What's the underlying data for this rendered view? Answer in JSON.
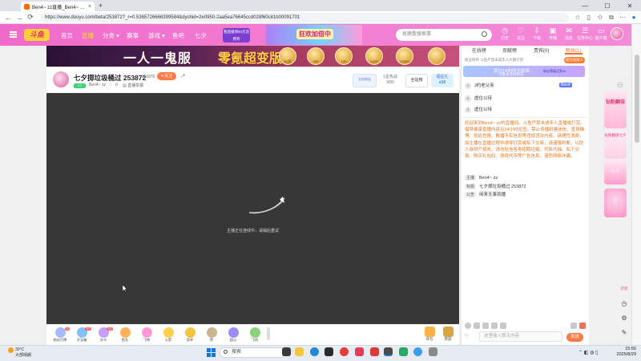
{
  "browser": {
    "tab_title": "Ben4~ zz直播_Ben4~ zz直播_Be...",
    "tab_close": "×",
    "new_tab": "+",
    "url": "https://www.douyu.com/beta/253872?_r=0.5365726666399584&dyshid=2e0950-2aa5ea76645ccd028f60c81b00091701",
    "nav_back": "←",
    "nav_forward": "→",
    "nav_reload": "⟳"
  },
  "site": {
    "logo": "斗鱼",
    "nav": [
      "首页",
      "直播",
      "分类",
      "赛事",
      "游戏",
      "鱼吧",
      "七夕"
    ],
    "promo_small": "看直播领60元话费券",
    "promo_banner": "狂欢加倍中",
    "search_placeholder": "斑鹿散搜索事",
    "header_icons": [
      "历史",
      "关注",
      "下载",
      "开播",
      "消息",
      "任务中心",
      "客户端"
    ]
  },
  "banner": {
    "text1": "一人一鬼服",
    "text2": "零氪超变版",
    "coins": [
      "5Q奖",
      "200",
      "100",
      "1Q2P",
      "12300"
    ]
  },
  "room": {
    "title": "七夕掷垃圾桶过 253872",
    "hot": "110976",
    "follow": "♥ 关注",
    "level": "LV",
    "anchor": "Ben4~ zz",
    "count": "0",
    "report": "直播举报",
    "fans_label": "全站粉丝",
    "fans_val": "1星热战",
    "fans_sub": "9/80",
    "rank_btn": "全站榜",
    "lucky": "福星礼",
    "lucky_x": "x10"
  },
  "video": {
    "message": "主播正在连线中，请稍后重试"
  },
  "gifts": [
    {
      "label": "粉丝灯牌",
      "color": "#a6b9ff",
      "badge": "40"
    },
    {
      "label": "开宝箱",
      "color": "#7fc0ff",
      "badge": "300"
    },
    {
      "label": "办卡",
      "color": "#c99cff",
      "badge": "300"
    },
    {
      "label": "鱼丸",
      "color": "#ffb15c",
      "badge": ""
    },
    {
      "label": "飞吻",
      "color": "#ff9ad2",
      "badge": ""
    },
    {
      "label": "火箭",
      "color": "#ffcf4f",
      "badge": ""
    },
    {
      "label": "奖杯",
      "color": "#f5c542",
      "badge": ""
    },
    {
      "label": "赞",
      "color": "#c9b58f",
      "badge": ""
    },
    {
      "label": "超火",
      "color": "#9b8cff",
      "badge": ""
    },
    {
      "label": "飞机",
      "color": "#8ad27c",
      "badge": ""
    }
  ],
  "gift_right": [
    {
      "label": "背包",
      "color": "#ffb347"
    },
    {
      "label": "贵族",
      "color": "#d9a441"
    }
  ],
  "panel": {
    "tabs": [
      "在线榜",
      "贡献榜",
      "贵宾(0)",
      "粉丝(1)"
    ],
    "sub_note": "粉丝榜单  斗鱼严禁未成年人大额打赏",
    "rank_btn": "成为贡献人",
    "fan_banner": "我与TA的时光勋章",
    "fan_banner_sub": "粉丝等级达到14",
    "rank_items": [
      {
        "num": "1",
        "name": "乌鲁木齐的秋日"
      },
      {
        "num": "1",
        "name": "J约老父亲"
      },
      {
        "num": "2",
        "name": "虚位以待"
      },
      {
        "num": "3",
        "name": "虚位以待"
      }
    ],
    "rank_tag": "Ben4",
    "welcome": "欢迎来到Ben4~ zz的直播间。斗鱼严禁未成年人直播或打赏。倡导健康直播内容且24小时巡查。禁止传播封建迷信、宣扬赌博、低俗色情、散播不实信息等违规违法内容。请理性消费，如主播在直播过程中诱导打赏或私下交易，请谨慎判断，以防人身财产损失。请勿轻信各类招聘征婚、代练代抽、私下交易、购买礼包码、游戏代币等广告信息，谨防网络诈骗。",
    "info": [
      {
        "k": "主播",
        "v": "Ben4~ zz"
      },
      {
        "k": "标题",
        "v": "七夕掷垃圾桶过 253872"
      },
      {
        "k": "公告",
        "v": "闲来无事就播"
      }
    ],
    "chat_placeholder": "这里输入聊天内容",
    "send": "发送"
  },
  "sidebar": {
    "promos": [
      {
        "text": "钻粉翻倍",
        "color": "#ffd1e8"
      },
      {
        "text": "钻粉翻倍七夕",
        "color": "#ffe0ee"
      },
      {
        "text": "七夕",
        "color": "#ffd9ea"
      },
      {
        "text": "",
        "color": "#ffc6e0"
      }
    ],
    "btn_new": "新版"
  },
  "taskbar": {
    "weather_temp": "30°C",
    "weather_desc": "大部晴朗",
    "search": "搜索",
    "time": "15:56",
    "date": "2025/8/29"
  }
}
